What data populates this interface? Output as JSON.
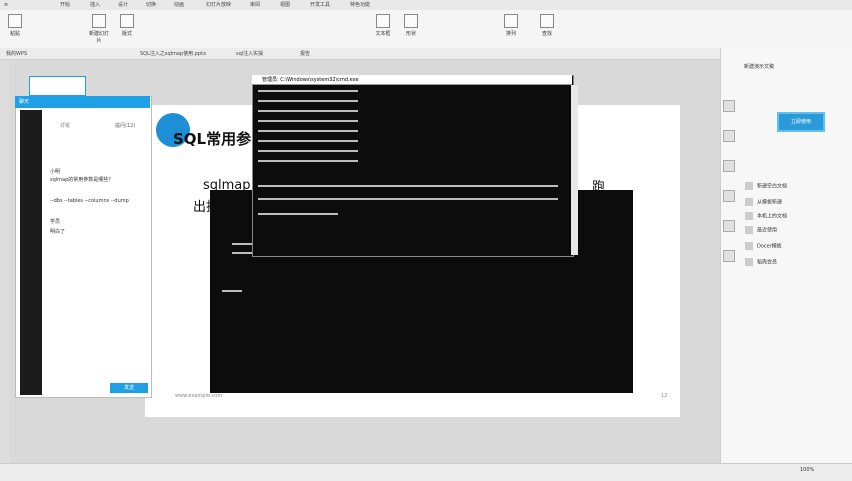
{
  "menu_tabs": [
    "开始",
    "插入",
    "设计",
    "切换",
    "动画",
    "幻灯片放映",
    "审阅",
    "视图",
    "开发工具",
    "特色功能"
  ],
  "ribbon_buttons": [
    "粘贴",
    "新建幻灯片",
    "版式",
    "文本框",
    "形状",
    "排列",
    "查找"
  ],
  "doc_tabs": [
    "我的WPS",
    "SQL注入之sqlmap使用.pptx",
    "sql注入实操",
    "报告"
  ],
  "chat": {
    "header_label": "聊天",
    "tab_left": "讨论",
    "tab_right": "提问(12)",
    "messages": [
      {
        "user": "小明",
        "text": "sqlmap的常用参数是哪些？"
      },
      {
        "user": "老师",
        "text": "--dbs --tables --columns --dump"
      },
      {
        "user": "学员",
        "text": "明白了"
      }
    ],
    "send_label": "发送"
  },
  "slide": {
    "title": "SQL常用参",
    "line1": "sqlmap",
    "line2": "出指定",
    "tail": "跑",
    "page_number": "12",
    "footer": "www.example.com"
  },
  "terminal1": {
    "title": "管理员: C:\\Windows\\system32\\cmd.exe"
  },
  "right_panel": {
    "title": "新建演示文稿",
    "action_button": "立即使用",
    "items": [
      "新建空白文档",
      "从模板新建",
      "本机上的文档",
      "最近使用",
      "Docer模板",
      "稻壳会员"
    ]
  },
  "status": {
    "zoom": "100%"
  }
}
